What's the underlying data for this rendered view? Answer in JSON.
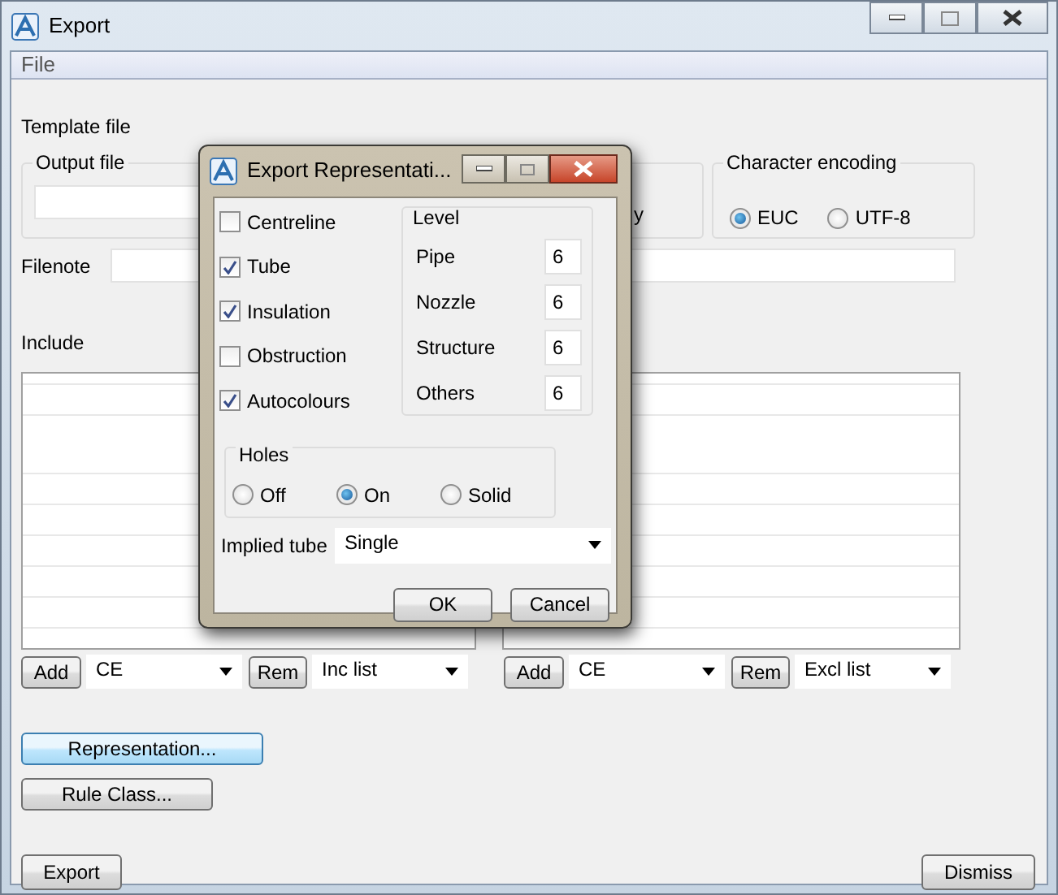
{
  "window": {
    "title": "Export"
  },
  "menu": [
    {
      "label": "File"
    }
  ],
  "template_label": "Template file",
  "output_file": {
    "label": "Output file"
  },
  "hidden_group_label": "y",
  "character_encoding": {
    "label": "Character encoding",
    "options": [
      {
        "label": "EUC",
        "selected": true
      },
      {
        "label": "UTF-8",
        "selected": false
      }
    ]
  },
  "filenote": {
    "label": "Filenote"
  },
  "include": {
    "label": "Include"
  },
  "lists": [
    {
      "add": "Add",
      "element_type": "CE",
      "remove": "Rem",
      "list_type": "Inc list"
    },
    {
      "add": "Add",
      "element_type": "CE",
      "remove": "Rem",
      "list_type": "Excl list"
    }
  ],
  "buttons": [
    {
      "label": "Representation...",
      "focused": true
    },
    {
      "label": "Rule Class...",
      "focused": false
    }
  ],
  "footer": {
    "export": "Export",
    "dismiss": "Dismiss"
  },
  "dialog": {
    "title": "Export Representati...",
    "options": [
      {
        "label": "Centreline",
        "checked": false
      },
      {
        "label": "Tube",
        "checked": true
      },
      {
        "label": "Insulation",
        "checked": true
      },
      {
        "label": "Obstruction",
        "checked": false
      },
      {
        "label": "Autocolours",
        "checked": true
      }
    ],
    "level": {
      "label": "Level",
      "rows": [
        {
          "label": "Pipe",
          "value": "6"
        },
        {
          "label": "Nozzle",
          "value": "6"
        },
        {
          "label": "Structure",
          "value": "6"
        },
        {
          "label": "Others",
          "value": "6"
        }
      ]
    },
    "holes": {
      "label": "Holes",
      "options": [
        {
          "label": "Off",
          "selected": false
        },
        {
          "label": "On",
          "selected": true
        },
        {
          "label": "Solid",
          "selected": false
        }
      ]
    },
    "implied_tube": {
      "label": "Implied tube",
      "value": "Single"
    },
    "buttons": [
      "OK",
      "Cancel"
    ]
  }
}
